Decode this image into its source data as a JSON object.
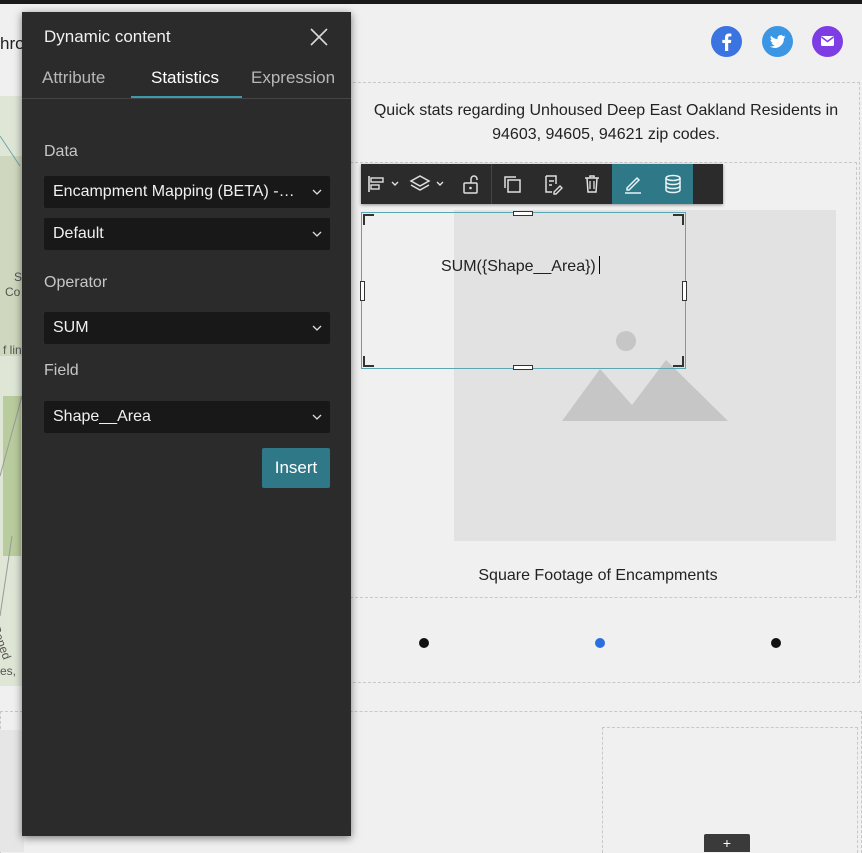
{
  "page": {
    "header_text": "hro",
    "quick_stats": "Quick stats regarding Unhoused Deep East Oakland Residents in 94603, 94605, 94621 zip codes.",
    "caption": "Square Footage of Encampments",
    "sum_expression": "SUM({Shape__Area})",
    "bottom_button": "+"
  },
  "map_labels": [
    "S",
    "Co",
    "f lin",
    "Bened",
    "es,"
  ],
  "social": [
    {
      "name": "facebook-icon",
      "color": "#3b73e0"
    },
    {
      "name": "twitter-icon",
      "color": "#3b97e3"
    },
    {
      "name": "email-icon",
      "color": "#7e3de4"
    }
  ],
  "toolbar": {
    "items": [
      "align-icon",
      "layers-icon",
      "unlock-icon",
      "duplicate-icon",
      "edit-dynamic-icon",
      "trash-icon",
      "pencil-icon",
      "database-icon"
    ],
    "accent": "#2f7887"
  },
  "carousel": {
    "active_index": 1,
    "dot_color": "#111111",
    "active_color": "#2b6ee0"
  },
  "panel": {
    "title": "Dynamic content",
    "tabs": [
      {
        "label": "Attribute",
        "active": false
      },
      {
        "label": "Statistics",
        "active": true
      },
      {
        "label": "Expression",
        "active": false
      }
    ],
    "data_label": "Data",
    "data_source": "Encampment Mapping (BETA) - Encampments",
    "data_view": "Default",
    "operator_label": "Operator",
    "operator_value": "SUM",
    "field_label": "Field",
    "field_value": "Shape__Area",
    "insert_label": "Insert"
  }
}
